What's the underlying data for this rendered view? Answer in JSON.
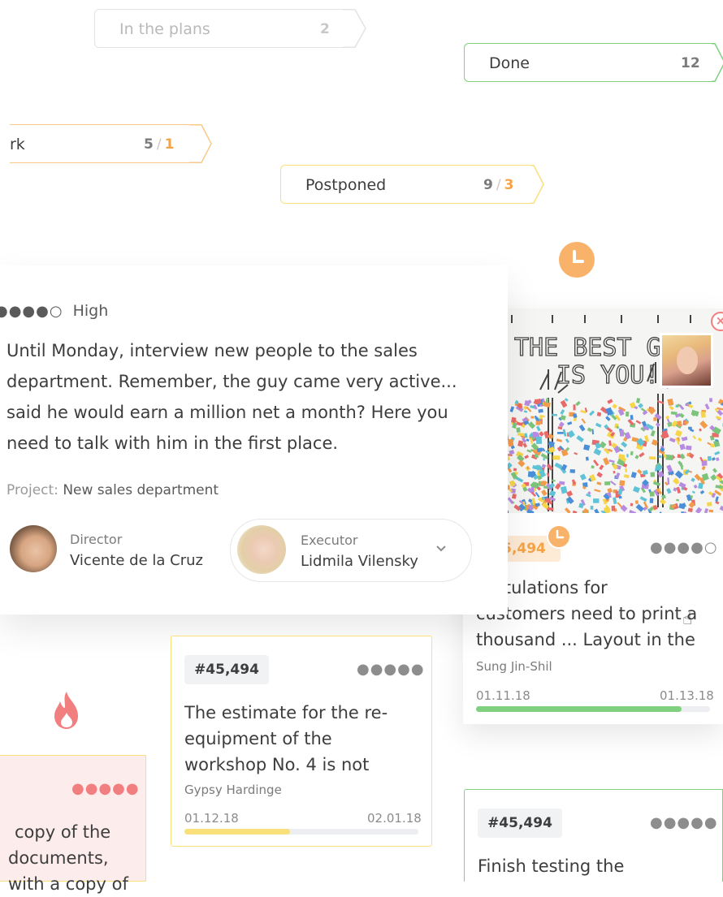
{
  "tags": {
    "plans": {
      "label": "In the plans",
      "count": "2"
    },
    "done": {
      "label": "Done",
      "count": "12"
    },
    "work": {
      "label": "rk",
      "count": "5",
      "extra": "1"
    },
    "postponed": {
      "label": "Postponed",
      "count": "9",
      "extra": "3"
    }
  },
  "main_card": {
    "priority_dots": "●●●●○",
    "priority": "High",
    "description_lines": [
      "Until Monday, interview new people to the sales",
      "department. Remember, the guy came very active...",
      "said he would earn a million net a month? Here you",
      "need to talk with him in the first place."
    ],
    "project_label": "Project:",
    "project_value": "New sales department",
    "director_label": "Director",
    "director_name": "Vicente de la Cruz",
    "executor_label": "Executor",
    "executor_name": "Lidmila Vilensky"
  },
  "image_card": {
    "id": "5,494",
    "dots": "●●●●○",
    "title_lines": [
      "gratulations for",
      "customers need to print a",
      "thousand ... Layout in the"
    ],
    "author": "Sung Jin-Shil",
    "date_start": "01.11.18",
    "date_end": "01.13.18",
    "progress": 0.88,
    "image_text_1": "THE BEST G",
    "image_text_2": "IS YOU!"
  },
  "mid_card": {
    "id": "#45,494",
    "dots": "●●●●●",
    "title_lines": [
      "The estimate for the re-",
      "equipment of the",
      "workshop No. 4 is not"
    ],
    "author": "Gypsy Hardinge",
    "date_start": "01.12.18",
    "date_end": "02.01.18",
    "progress": 0.45
  },
  "pink_card": {
    "dots": "●●●●●",
    "text_lines": [
      "copy of the",
      "documents,",
      "with a copy of"
    ]
  },
  "bottom_card": {
    "id": "#45,494",
    "dots": "●●●●●",
    "title": "Finish testing the"
  },
  "colors": {
    "green": "#7fd07f",
    "yellow": "#f9e07a",
    "orange": "#f5a344",
    "pink": "#fdecec",
    "pink_dots": "#f27f7f",
    "gray_dots": "#8d8d8d"
  },
  "icons": [
    "clock-icon",
    "fire-icon",
    "close-icon",
    "chevron-down-icon",
    "hand-cursor-icon"
  ]
}
